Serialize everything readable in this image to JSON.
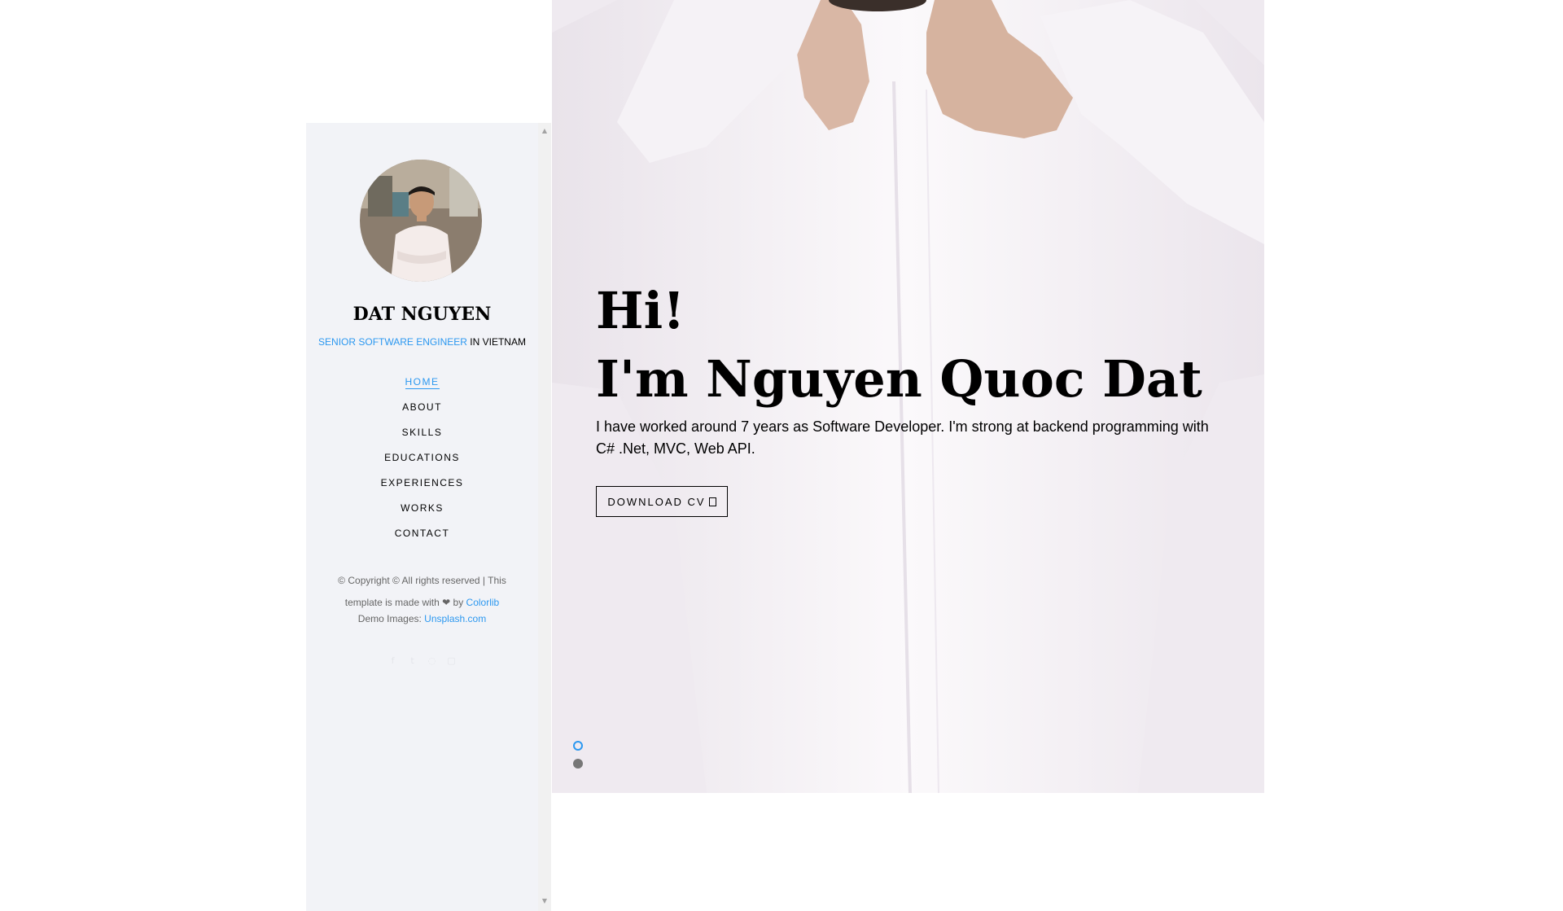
{
  "sidebar": {
    "name": "DAT NGUYEN",
    "tagline_role": "SENIOR SOFTWARE ENGINEER",
    "tagline_location": " IN VIETNAM",
    "nav": [
      {
        "label": "HOME",
        "active": true
      },
      {
        "label": "ABOUT",
        "active": false
      },
      {
        "label": "SKILLS",
        "active": false
      },
      {
        "label": "EDUCATIONS",
        "active": false
      },
      {
        "label": "EXPERIENCES",
        "active": false
      },
      {
        "label": "WORKS",
        "active": false
      },
      {
        "label": "CONTACT",
        "active": false
      }
    ],
    "copyright_text": "© Copyright © All rights reserved | This template is made with ❤ by ",
    "copyright_link": "Colorlib",
    "demo_label": "Demo Images: ",
    "demo_link": "Unsplash.com",
    "social_icons": [
      "facebook-icon",
      "twitter-icon",
      "instagram-icon",
      "linkedin-icon"
    ]
  },
  "hero": {
    "greeting": "Hi!",
    "headline": "I'm Nguyen Quoc Dat",
    "description": "I have worked around 7 years as Software Developer. I'm strong at backend programming with C# .Net, MVC, Web API.",
    "button_label": "DOWNLOAD CV",
    "slides": 2,
    "active_slide": 1
  },
  "colors": {
    "accent": "#2c98f0",
    "sidebar_bg": "#f2f3f7",
    "text": "#000000"
  }
}
